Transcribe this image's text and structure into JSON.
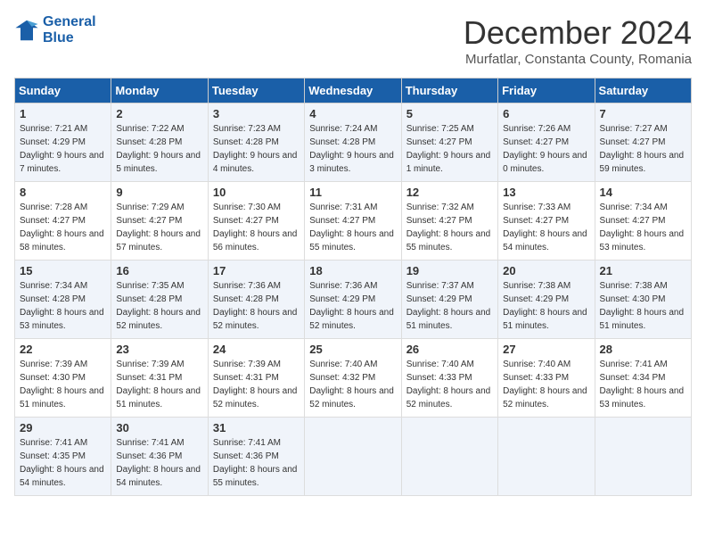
{
  "header": {
    "logo_line1": "General",
    "logo_line2": "Blue",
    "month_title": "December 2024",
    "subtitle": "Murfatlar, Constanta County, Romania"
  },
  "days_of_week": [
    "Sunday",
    "Monday",
    "Tuesday",
    "Wednesday",
    "Thursday",
    "Friday",
    "Saturday"
  ],
  "weeks": [
    [
      {
        "num": "1",
        "sunrise": "Sunrise: 7:21 AM",
        "sunset": "Sunset: 4:29 PM",
        "daylight": "Daylight: 9 hours and 7 minutes."
      },
      {
        "num": "2",
        "sunrise": "Sunrise: 7:22 AM",
        "sunset": "Sunset: 4:28 PM",
        "daylight": "Daylight: 9 hours and 5 minutes."
      },
      {
        "num": "3",
        "sunrise": "Sunrise: 7:23 AM",
        "sunset": "Sunset: 4:28 PM",
        "daylight": "Daylight: 9 hours and 4 minutes."
      },
      {
        "num": "4",
        "sunrise": "Sunrise: 7:24 AM",
        "sunset": "Sunset: 4:28 PM",
        "daylight": "Daylight: 9 hours and 3 minutes."
      },
      {
        "num": "5",
        "sunrise": "Sunrise: 7:25 AM",
        "sunset": "Sunset: 4:27 PM",
        "daylight": "Daylight: 9 hours and 1 minute."
      },
      {
        "num": "6",
        "sunrise": "Sunrise: 7:26 AM",
        "sunset": "Sunset: 4:27 PM",
        "daylight": "Daylight: 9 hours and 0 minutes."
      },
      {
        "num": "7",
        "sunrise": "Sunrise: 7:27 AM",
        "sunset": "Sunset: 4:27 PM",
        "daylight": "Daylight: 8 hours and 59 minutes."
      }
    ],
    [
      {
        "num": "8",
        "sunrise": "Sunrise: 7:28 AM",
        "sunset": "Sunset: 4:27 PM",
        "daylight": "Daylight: 8 hours and 58 minutes."
      },
      {
        "num": "9",
        "sunrise": "Sunrise: 7:29 AM",
        "sunset": "Sunset: 4:27 PM",
        "daylight": "Daylight: 8 hours and 57 minutes."
      },
      {
        "num": "10",
        "sunrise": "Sunrise: 7:30 AM",
        "sunset": "Sunset: 4:27 PM",
        "daylight": "Daylight: 8 hours and 56 minutes."
      },
      {
        "num": "11",
        "sunrise": "Sunrise: 7:31 AM",
        "sunset": "Sunset: 4:27 PM",
        "daylight": "Daylight: 8 hours and 55 minutes."
      },
      {
        "num": "12",
        "sunrise": "Sunrise: 7:32 AM",
        "sunset": "Sunset: 4:27 PM",
        "daylight": "Daylight: 8 hours and 55 minutes."
      },
      {
        "num": "13",
        "sunrise": "Sunrise: 7:33 AM",
        "sunset": "Sunset: 4:27 PM",
        "daylight": "Daylight: 8 hours and 54 minutes."
      },
      {
        "num": "14",
        "sunrise": "Sunrise: 7:34 AM",
        "sunset": "Sunset: 4:27 PM",
        "daylight": "Daylight: 8 hours and 53 minutes."
      }
    ],
    [
      {
        "num": "15",
        "sunrise": "Sunrise: 7:34 AM",
        "sunset": "Sunset: 4:28 PM",
        "daylight": "Daylight: 8 hours and 53 minutes."
      },
      {
        "num": "16",
        "sunrise": "Sunrise: 7:35 AM",
        "sunset": "Sunset: 4:28 PM",
        "daylight": "Daylight: 8 hours and 52 minutes."
      },
      {
        "num": "17",
        "sunrise": "Sunrise: 7:36 AM",
        "sunset": "Sunset: 4:28 PM",
        "daylight": "Daylight: 8 hours and 52 minutes."
      },
      {
        "num": "18",
        "sunrise": "Sunrise: 7:36 AM",
        "sunset": "Sunset: 4:29 PM",
        "daylight": "Daylight: 8 hours and 52 minutes."
      },
      {
        "num": "19",
        "sunrise": "Sunrise: 7:37 AM",
        "sunset": "Sunset: 4:29 PM",
        "daylight": "Daylight: 8 hours and 51 minutes."
      },
      {
        "num": "20",
        "sunrise": "Sunrise: 7:38 AM",
        "sunset": "Sunset: 4:29 PM",
        "daylight": "Daylight: 8 hours and 51 minutes."
      },
      {
        "num": "21",
        "sunrise": "Sunrise: 7:38 AM",
        "sunset": "Sunset: 4:30 PM",
        "daylight": "Daylight: 8 hours and 51 minutes."
      }
    ],
    [
      {
        "num": "22",
        "sunrise": "Sunrise: 7:39 AM",
        "sunset": "Sunset: 4:30 PM",
        "daylight": "Daylight: 8 hours and 51 minutes."
      },
      {
        "num": "23",
        "sunrise": "Sunrise: 7:39 AM",
        "sunset": "Sunset: 4:31 PM",
        "daylight": "Daylight: 8 hours and 51 minutes."
      },
      {
        "num": "24",
        "sunrise": "Sunrise: 7:39 AM",
        "sunset": "Sunset: 4:31 PM",
        "daylight": "Daylight: 8 hours and 52 minutes."
      },
      {
        "num": "25",
        "sunrise": "Sunrise: 7:40 AM",
        "sunset": "Sunset: 4:32 PM",
        "daylight": "Daylight: 8 hours and 52 minutes."
      },
      {
        "num": "26",
        "sunrise": "Sunrise: 7:40 AM",
        "sunset": "Sunset: 4:33 PM",
        "daylight": "Daylight: 8 hours and 52 minutes."
      },
      {
        "num": "27",
        "sunrise": "Sunrise: 7:40 AM",
        "sunset": "Sunset: 4:33 PM",
        "daylight": "Daylight: 8 hours and 52 minutes."
      },
      {
        "num": "28",
        "sunrise": "Sunrise: 7:41 AM",
        "sunset": "Sunset: 4:34 PM",
        "daylight": "Daylight: 8 hours and 53 minutes."
      }
    ],
    [
      {
        "num": "29",
        "sunrise": "Sunrise: 7:41 AM",
        "sunset": "Sunset: 4:35 PM",
        "daylight": "Daylight: 8 hours and 54 minutes."
      },
      {
        "num": "30",
        "sunrise": "Sunrise: 7:41 AM",
        "sunset": "Sunset: 4:36 PM",
        "daylight": "Daylight: 8 hours and 54 minutes."
      },
      {
        "num": "31",
        "sunrise": "Sunrise: 7:41 AM",
        "sunset": "Sunset: 4:36 PM",
        "daylight": "Daylight: 8 hours and 55 minutes."
      },
      {
        "num": "",
        "sunrise": "",
        "sunset": "",
        "daylight": ""
      },
      {
        "num": "",
        "sunrise": "",
        "sunset": "",
        "daylight": ""
      },
      {
        "num": "",
        "sunrise": "",
        "sunset": "",
        "daylight": ""
      },
      {
        "num": "",
        "sunrise": "",
        "sunset": "",
        "daylight": ""
      }
    ]
  ]
}
